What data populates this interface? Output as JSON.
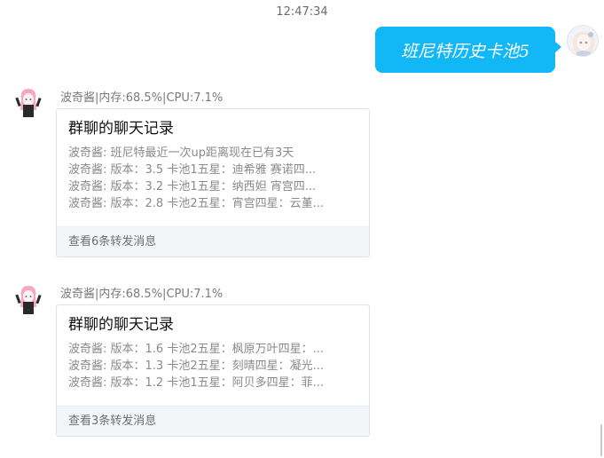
{
  "timestamp": "12:47:34",
  "outgoing": {
    "text": "班尼特历史卡池5"
  },
  "messages": [
    {
      "sender": "波奇酱|内存:68.5%|CPU:7.1%",
      "card_title": "群聊的聊天记录",
      "lines": [
        "波奇酱: 班尼特最近一次up距离现在已有3天",
        "波奇酱: 版本：3.5  卡池1五星：迪希雅 赛诺四...",
        "波奇酱: 版本：3.2  卡池1五星：纳西妲 宵宫四...",
        "波奇酱: 版本：2.8  卡池2五星：宵宫四星：云堇..."
      ],
      "footer": "查看6条转发消息"
    },
    {
      "sender": "波奇酱|内存:68.5%|CPU:7.1%",
      "card_title": "群聊的聊天记录",
      "lines": [
        "波奇酱: 版本：1.6  卡池2五星：枫原万叶四星：...",
        "波奇酱: 版本：1.3  卡池2五星：刻晴四星：凝光...",
        "波奇酱: 版本：1.2  卡池1五星：阿贝多四星：菲..."
      ],
      "footer": "查看3条转发消息"
    }
  ],
  "colors": {
    "bubble": "#12b7f5",
    "card_footer": "#f3f6f9"
  }
}
